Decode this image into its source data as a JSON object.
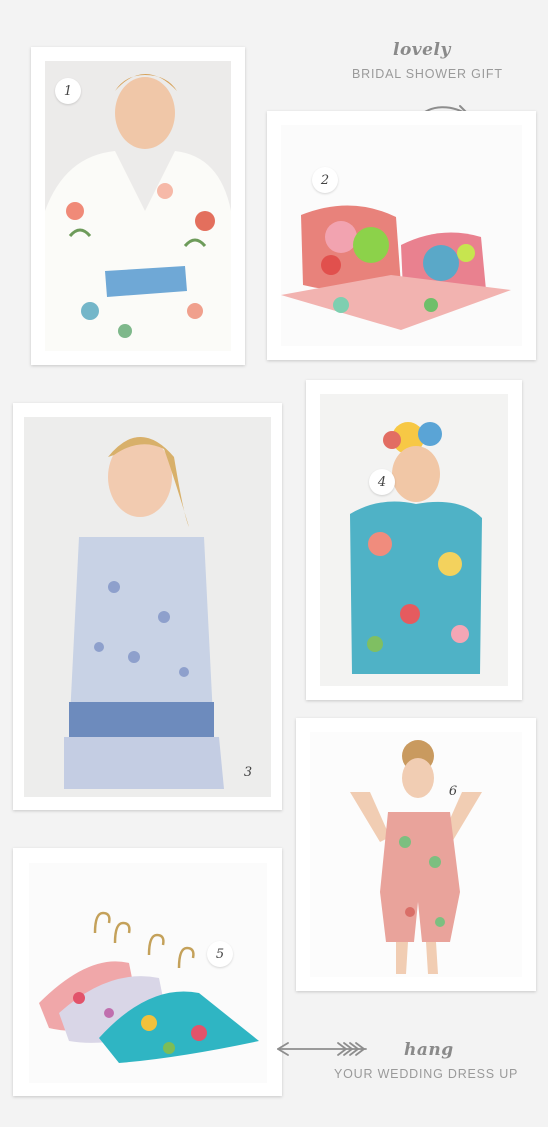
{
  "theme": {
    "background": "#f3f3f3",
    "frame": "#ffffff",
    "accent_text": "#8a8a8a"
  },
  "top_caption": {
    "script": "lovely",
    "caps": "BRIDAL SHOWER GIFT"
  },
  "bottom_caption": {
    "script": "hang",
    "caps": "YOUR WEDDING DRESS UP"
  },
  "items": [
    {
      "number": "1"
    },
    {
      "number": "2"
    },
    {
      "number": "3"
    },
    {
      "number": "4"
    },
    {
      "number": "5"
    },
    {
      "number": "6"
    }
  ],
  "icons": {
    "top_arrow": "curly-arrow-icon",
    "bottom_arrow": "feather-arrow-icon"
  }
}
